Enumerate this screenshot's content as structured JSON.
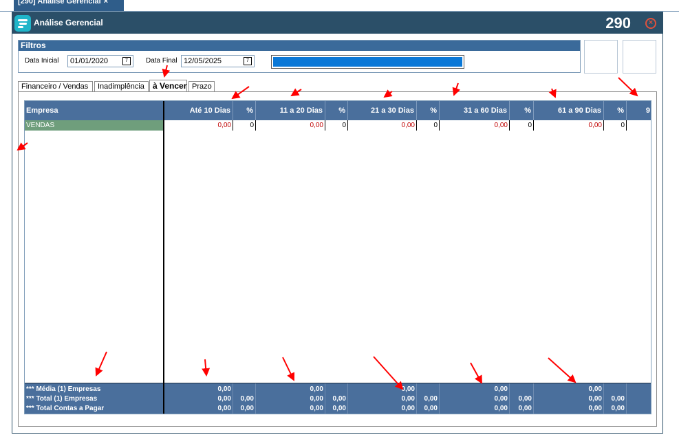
{
  "top_tab": {
    "label": "[290] Análise Gerencial",
    "close": "×"
  },
  "window": {
    "title": "Análise Gerencial",
    "code": "290",
    "close_icon": "close-circle-icon"
  },
  "filtros": {
    "title": "Filtros",
    "data_inicial_label": "Data Inicial",
    "data_inicial": "01/01/2020",
    "data_final_label": "Data Final",
    "data_final": "12/05/2025",
    "calendar_icon": "calendar-icon",
    "progress": 1.0
  },
  "tabs": [
    "Financeiro / Vendas",
    "Inadimplência",
    "à Vencer",
    "Prazo"
  ],
  "active_tab": "à Vencer",
  "grid": {
    "headers": [
      "Empresa",
      "Até 10 Dias",
      "%",
      "11 a 20 Dias",
      "%",
      "21 a 30 Dias",
      "%",
      "31 a 60 Dias",
      "%",
      "61 a 90 Dias",
      "%",
      "9"
    ],
    "rows": [
      {
        "empresa": "VENDAS",
        "v1": "0,00",
        "p1": "0",
        "v2": "0,00",
        "p2": "0",
        "v3": "0,00",
        "p3": "0",
        "v4": "0,00",
        "p4": "0",
        "v5": "0,00",
        "p5": "0"
      }
    ],
    "footer": [
      {
        "label": "*** Média (1) Empresas",
        "v1": "0,00",
        "p1": "",
        "v2": "0,00",
        "p2": "",
        "v3": "0,00",
        "p3": "",
        "v4": "0,00",
        "p4": "",
        "v5": "0,00",
        "p5": ""
      },
      {
        "label": "*** Total (1) Empresas",
        "v1": "0,00",
        "p1": "0,00",
        "v2": "0,00",
        "p2": "0,00",
        "v3": "0,00",
        "p3": "0,00",
        "v4": "0,00",
        "p4": "0,00",
        "v5": "0,00",
        "p5": "0,00"
      },
      {
        "label": "*** Total Contas a Pagar",
        "v1": "0,00",
        "p1": "0,00",
        "v2": "0,00",
        "p2": "0,00",
        "v3": "0,00",
        "p3": "0,00",
        "v4": "0,00",
        "p4": "0,00",
        "v5": "0,00",
        "p5": "0,00"
      }
    ]
  },
  "colors": {
    "titlebar": "#2b4f68",
    "grid_header": "#4a6f9c",
    "selected_row": "#6f9e7c",
    "negative_text": "#c00000",
    "progress": "#0a78d7",
    "annotation_arrow": "#ff0000"
  }
}
